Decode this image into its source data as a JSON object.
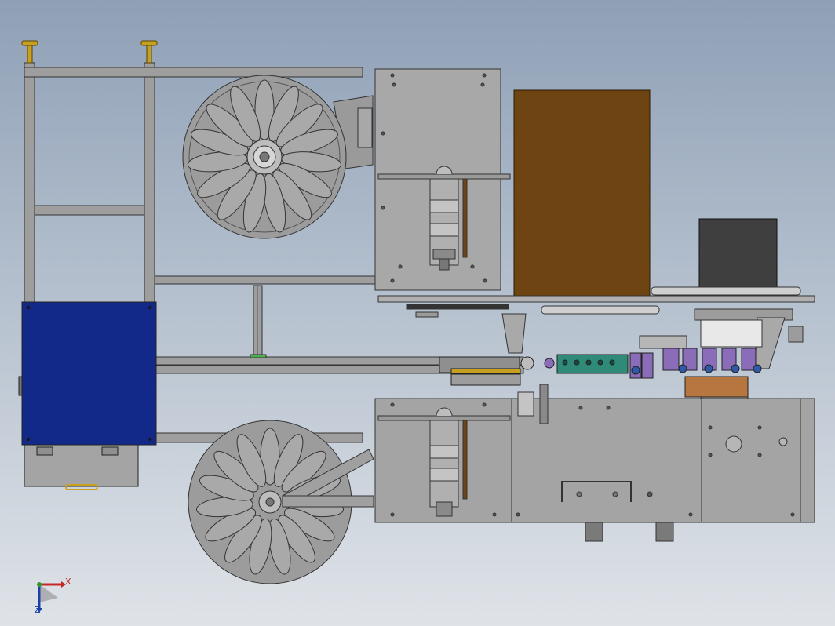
{
  "viewport": {
    "background_top": "#8fa0b6",
    "background_bottom": "#dfe3e8"
  },
  "colors": {
    "frame_gray": "#9e9e9e",
    "panel_gray": "#a7a7a7",
    "edge": "#333333",
    "brown_box": "#6e4512",
    "dark_box": "#3f3f3f",
    "blue_panel": "#13298a",
    "brass": "#c8a020",
    "green_part": "#2f8a78",
    "purple_part": "#8b6cb8",
    "orange_part": "#b7763f"
  },
  "triad": {
    "x_label": "X",
    "z_label": "Z",
    "x_color": "#c62828",
    "y_color": "#2e9a2e",
    "z_color": "#1d3fa8"
  }
}
